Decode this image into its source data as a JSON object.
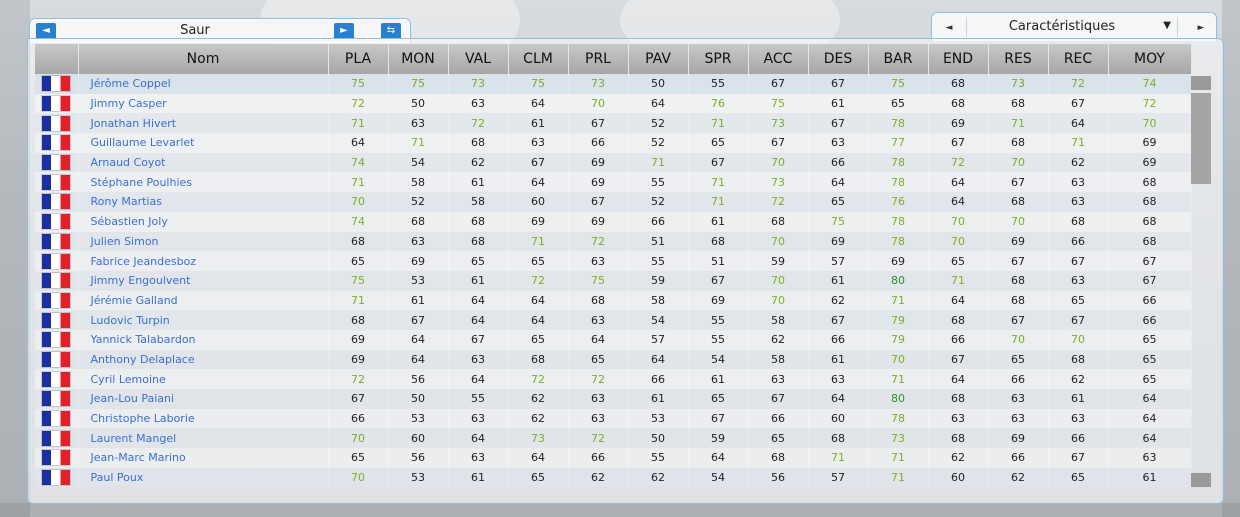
{
  "team": {
    "name": "Saur",
    "prev_icon": "◄",
    "next_icon": "►",
    "action_icon": "⇆"
  },
  "view": {
    "selected": "Caractéristiques",
    "prev_icon": "◄",
    "next_icon": "►",
    "dropdown_icon": "▼"
  },
  "colors": {
    "high": "#7ab026",
    "very_high": "#2f8f2f",
    "link": "#3a6fd0",
    "accent": "#2a7fd0"
  },
  "table": {
    "columns": [
      "",
      "Nom",
      "PLA",
      "MON",
      "VAL",
      "CLM",
      "PRL",
      "PAV",
      "SPR",
      "ACC",
      "DES",
      "BAR",
      "END",
      "RES",
      "REC",
      "MOY"
    ],
    "rows": [
      {
        "name": "Jérôme Coppel",
        "v": [
          75,
          75,
          73,
          75,
          73,
          50,
          55,
          67,
          67,
          75,
          68,
          73,
          72,
          74
        ]
      },
      {
        "name": "Jimmy Casper",
        "v": [
          72,
          50,
          63,
          64,
          70,
          64,
          76,
          75,
          61,
          65,
          68,
          68,
          67,
          72
        ]
      },
      {
        "name": "Jonathan Hivert",
        "v": [
          71,
          63,
          72,
          61,
          67,
          52,
          71,
          73,
          67,
          78,
          69,
          71,
          64,
          70
        ]
      },
      {
        "name": "Guillaume Levarlet",
        "v": [
          64,
          71,
          68,
          63,
          66,
          52,
          65,
          67,
          63,
          77,
          67,
          68,
          71,
          69
        ]
      },
      {
        "name": "Arnaud Coyot",
        "v": [
          74,
          54,
          62,
          67,
          69,
          71,
          67,
          70,
          66,
          78,
          72,
          70,
          62,
          69
        ]
      },
      {
        "name": "Stéphane Poulhies",
        "v": [
          71,
          58,
          61,
          64,
          69,
          55,
          71,
          73,
          64,
          78,
          64,
          67,
          63,
          68
        ]
      },
      {
        "name": "Rony Martias",
        "v": [
          70,
          52,
          58,
          60,
          67,
          52,
          71,
          72,
          65,
          76,
          64,
          68,
          63,
          68
        ]
      },
      {
        "name": "Sébastien Joly",
        "v": [
          74,
          68,
          68,
          69,
          69,
          66,
          61,
          68,
          75,
          78,
          70,
          70,
          68,
          68
        ]
      },
      {
        "name": "Julien Simon",
        "v": [
          68,
          63,
          68,
          71,
          72,
          51,
          68,
          70,
          69,
          78,
          70,
          69,
          66,
          68
        ]
      },
      {
        "name": "Fabrice Jeandesboz",
        "v": [
          65,
          69,
          65,
          65,
          63,
          55,
          51,
          59,
          57,
          69,
          65,
          67,
          67,
          67
        ]
      },
      {
        "name": "Jimmy Engoulvent",
        "v": [
          75,
          53,
          61,
          72,
          75,
          59,
          67,
          70,
          61,
          80,
          71,
          68,
          63,
          67
        ]
      },
      {
        "name": "Jérémie Galland",
        "v": [
          71,
          61,
          64,
          64,
          68,
          58,
          69,
          70,
          62,
          71,
          64,
          68,
          65,
          66
        ]
      },
      {
        "name": "Ludovic Turpin",
        "v": [
          68,
          67,
          64,
          64,
          63,
          54,
          55,
          58,
          67,
          79,
          68,
          67,
          67,
          66
        ]
      },
      {
        "name": "Yannick Talabardon",
        "v": [
          69,
          64,
          67,
          65,
          64,
          57,
          55,
          62,
          66,
          79,
          66,
          70,
          70,
          65
        ]
      },
      {
        "name": "Anthony Delaplace",
        "v": [
          69,
          64,
          63,
          68,
          65,
          64,
          54,
          58,
          61,
          70,
          67,
          65,
          68,
          65
        ]
      },
      {
        "name": "Cyril Lemoine",
        "v": [
          72,
          56,
          64,
          72,
          72,
          66,
          61,
          63,
          63,
          71,
          64,
          66,
          62,
          65
        ]
      },
      {
        "name": "Jean-Lou Paiani",
        "v": [
          67,
          50,
          55,
          62,
          63,
          61,
          65,
          67,
          64,
          80,
          68,
          63,
          61,
          64
        ]
      },
      {
        "name": "Christophe Laborie",
        "v": [
          66,
          53,
          63,
          62,
          63,
          53,
          67,
          66,
          60,
          78,
          63,
          63,
          63,
          64
        ]
      },
      {
        "name": "Laurent Mangel",
        "v": [
          70,
          60,
          64,
          73,
          72,
          50,
          59,
          65,
          68,
          73,
          68,
          69,
          66,
          64
        ]
      },
      {
        "name": "Jean-Marc Marino",
        "v": [
          65,
          56,
          63,
          64,
          66,
          55,
          64,
          68,
          71,
          71,
          62,
          66,
          67,
          63
        ]
      },
      {
        "name": "Paul Poux",
        "v": [
          70,
          53,
          61,
          65,
          62,
          62,
          54,
          56,
          57,
          71,
          60,
          62,
          65,
          61
        ]
      }
    ]
  }
}
